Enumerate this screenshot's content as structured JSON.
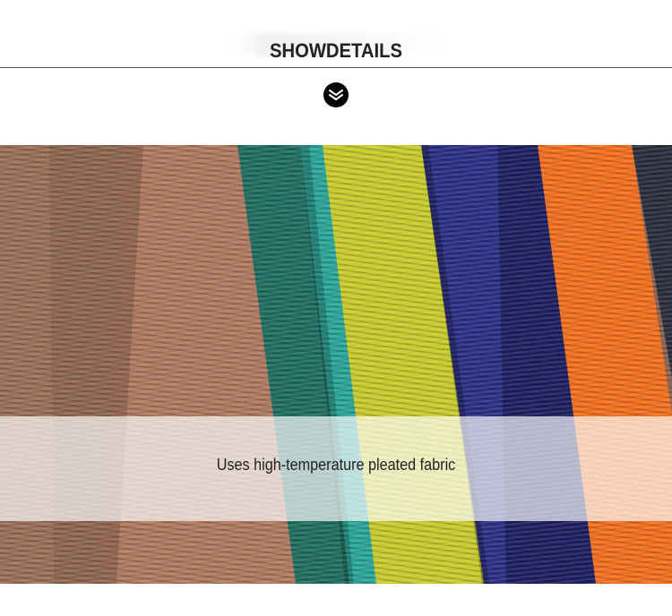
{
  "section": {
    "title": "SHOWDETAILS",
    "badge_icon": "double-chevron-down-icon"
  },
  "photo": {
    "alt_subject": "pleated fabric garments hanging",
    "colors": [
      "#9c6f58",
      "#b07a60",
      "#1f7b6e",
      "#2aa79a",
      "#c8cc2c",
      "#2b2f86",
      "#1c1f61",
      "#f5701e",
      "#2a2e3c"
    ],
    "caption": "Uses high-temperature pleated fabric"
  }
}
